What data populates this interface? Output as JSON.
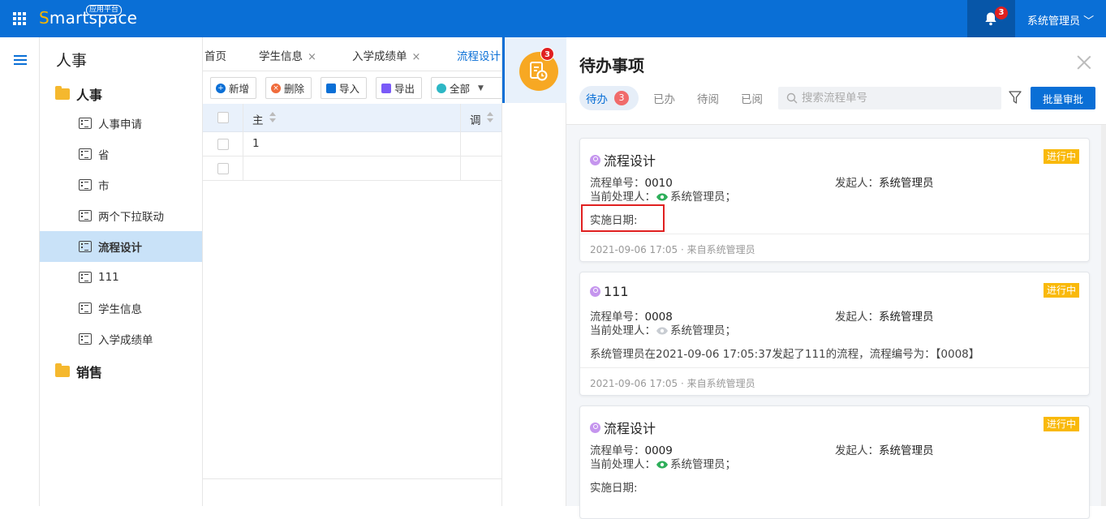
{
  "topbar": {
    "logo_prefix": "S",
    "logo_rest": "martspace",
    "logo_badge": "应用平台",
    "bell_count": "3",
    "user_name": "系统管理员"
  },
  "sidebar": {
    "title": "人事",
    "groups": [
      {
        "label": "人事"
      },
      {
        "label": "销售"
      }
    ],
    "items": [
      {
        "label": "人事申请"
      },
      {
        "label": "省"
      },
      {
        "label": "市"
      },
      {
        "label": "两个下拉联动"
      },
      {
        "label": "流程设计"
      },
      {
        "label": "111"
      },
      {
        "label": "学生信息"
      },
      {
        "label": "入学成绩单"
      }
    ]
  },
  "main": {
    "tabs": [
      {
        "label": "首页"
      },
      {
        "label": "学生信息",
        "close": "×"
      },
      {
        "label": "入学成绩单",
        "close": "×"
      },
      {
        "label": "流程设计"
      }
    ],
    "toolbar": {
      "add": "新增",
      "delete": "删除",
      "import": "导入",
      "export": "导出",
      "all": "全部"
    },
    "columns": [
      "主",
      "调"
    ],
    "rows": [
      {
        "col1": "1"
      },
      {
        "col1": ""
      }
    ]
  },
  "iconcol": {
    "badge": "3"
  },
  "panel": {
    "title": "待办事项",
    "tabs": [
      {
        "label": "待办",
        "count": "3"
      },
      {
        "label": "已办"
      },
      {
        "label": "待阅"
      },
      {
        "label": "已阅"
      }
    ],
    "search_placeholder": "搜索流程单号",
    "batch_button": "批量审批",
    "cards": [
      {
        "title": "流程设计",
        "status": "进行中",
        "order_label": "流程单号：",
        "order_no": "0010",
        "initiator_label": "发起人：",
        "initiator": "系统管理员",
        "handler_label": "当前处理人：",
        "handler": "系统管理员；",
        "detail": "实施日期:",
        "footer": "2021-09-06 17:05 · 来自系统管理员"
      },
      {
        "title": "111",
        "status": "进行中",
        "order_label": "流程单号：",
        "order_no": "0008",
        "initiator_label": "发起人：",
        "initiator": "系统管理员",
        "handler_label": "当前处理人：",
        "handler": "系统管理员；",
        "detail": "系统管理员在2021-09-06 17:05:37发起了111的流程，流程编号为：【0008】",
        "footer": "2021-09-06 17:05 · 来自系统管理员"
      },
      {
        "title": "流程设计",
        "status": "进行中",
        "order_label": "流程单号：",
        "order_no": "0009",
        "initiator_label": "发起人：",
        "initiator": "系统管理员",
        "handler_label": "当前处理人：",
        "handler": "系统管理员；",
        "detail": "实施日期:",
        "footer": ""
      }
    ]
  },
  "colors": {
    "brand": "#0a6fd6",
    "status": "#f9b90a",
    "badge": "#e02020"
  }
}
